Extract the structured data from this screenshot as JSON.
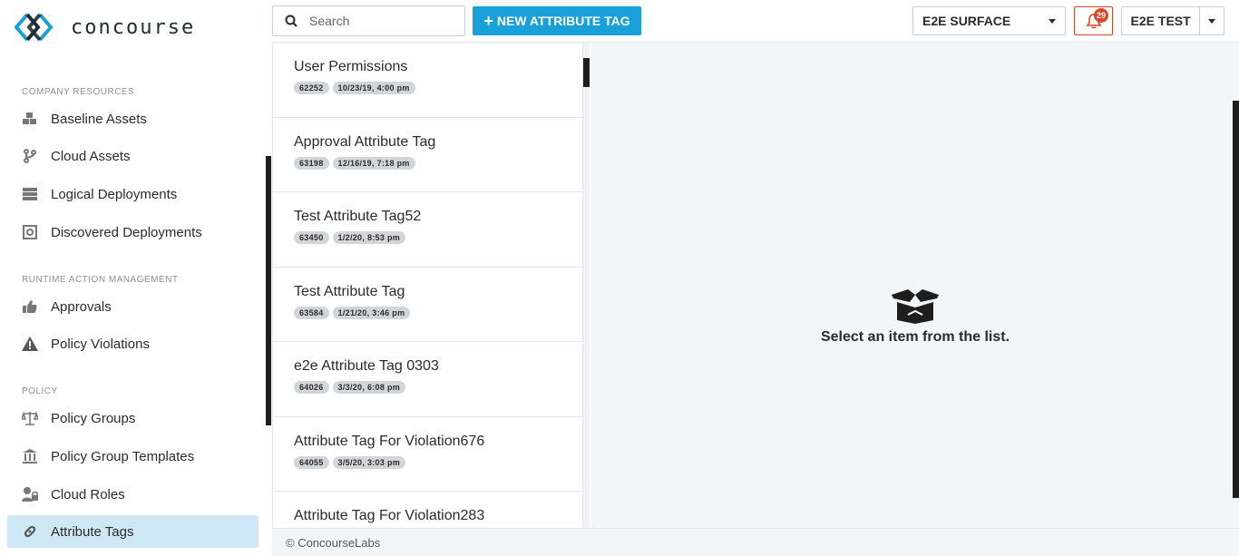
{
  "app": {
    "name": "concourse"
  },
  "sidebar": {
    "sections": [
      {
        "title": "COMPANY RESOURCES",
        "items": [
          {
            "label": "Baseline Assets",
            "icon": "cubes-icon"
          },
          {
            "label": "Cloud Assets",
            "icon": "code-branch-icon"
          },
          {
            "label": "Logical Deployments",
            "icon": "server-icon"
          },
          {
            "label": "Discovered Deployments",
            "icon": "discovered-icon"
          }
        ]
      },
      {
        "title": "RUNTIME ACTION MANAGEMENT",
        "items": [
          {
            "label": "Approvals",
            "icon": "thumbs-up-icon"
          },
          {
            "label": "Policy Violations",
            "icon": "warning-icon"
          }
        ]
      },
      {
        "title": "POLICY",
        "items": [
          {
            "label": "Policy Groups",
            "icon": "scale-icon"
          },
          {
            "label": "Policy Group Templates",
            "icon": "bank-icon"
          },
          {
            "label": "Cloud Roles",
            "icon": "user-lock-icon"
          },
          {
            "label": "Attribute Tags",
            "icon": "link-icon",
            "active": true
          }
        ]
      }
    ]
  },
  "topbar": {
    "search_placeholder": "Search",
    "new_button_label": "NEW ATTRIBUTE TAG",
    "environment": "E2E SURFACE",
    "notifications_count": "29",
    "user": "E2E TEST"
  },
  "list": {
    "items": [
      {
        "title": "User Permissions",
        "id": "62252",
        "date": "10/23/19, 4:00 pm"
      },
      {
        "title": "Approval Attribute Tag",
        "id": "63198",
        "date": "12/16/19, 7:18 pm"
      },
      {
        "title": "Test Attribute Tag52",
        "id": "63450",
        "date": "1/2/20, 8:53 pm"
      },
      {
        "title": "Test Attribute Tag",
        "id": "63584",
        "date": "1/21/20, 3:46 pm"
      },
      {
        "title": "e2e Attribute Tag 0303",
        "id": "64026",
        "date": "3/3/20, 6:08 pm"
      },
      {
        "title": "Attribute Tag For Violation676",
        "id": "64055",
        "date": "3/5/20, 3:03 pm"
      },
      {
        "title": "Attribute Tag For Violation283",
        "id": "",
        "date": ""
      }
    ]
  },
  "main": {
    "empty_message": "Select an item from the list."
  },
  "footer": {
    "copyright": "© ConcourseLabs"
  },
  "colors": {
    "accent": "#1aa0d8",
    "active_nav": "#cfe8f6",
    "alert": "#d9472b",
    "main_bg": "#f3f6f9"
  }
}
